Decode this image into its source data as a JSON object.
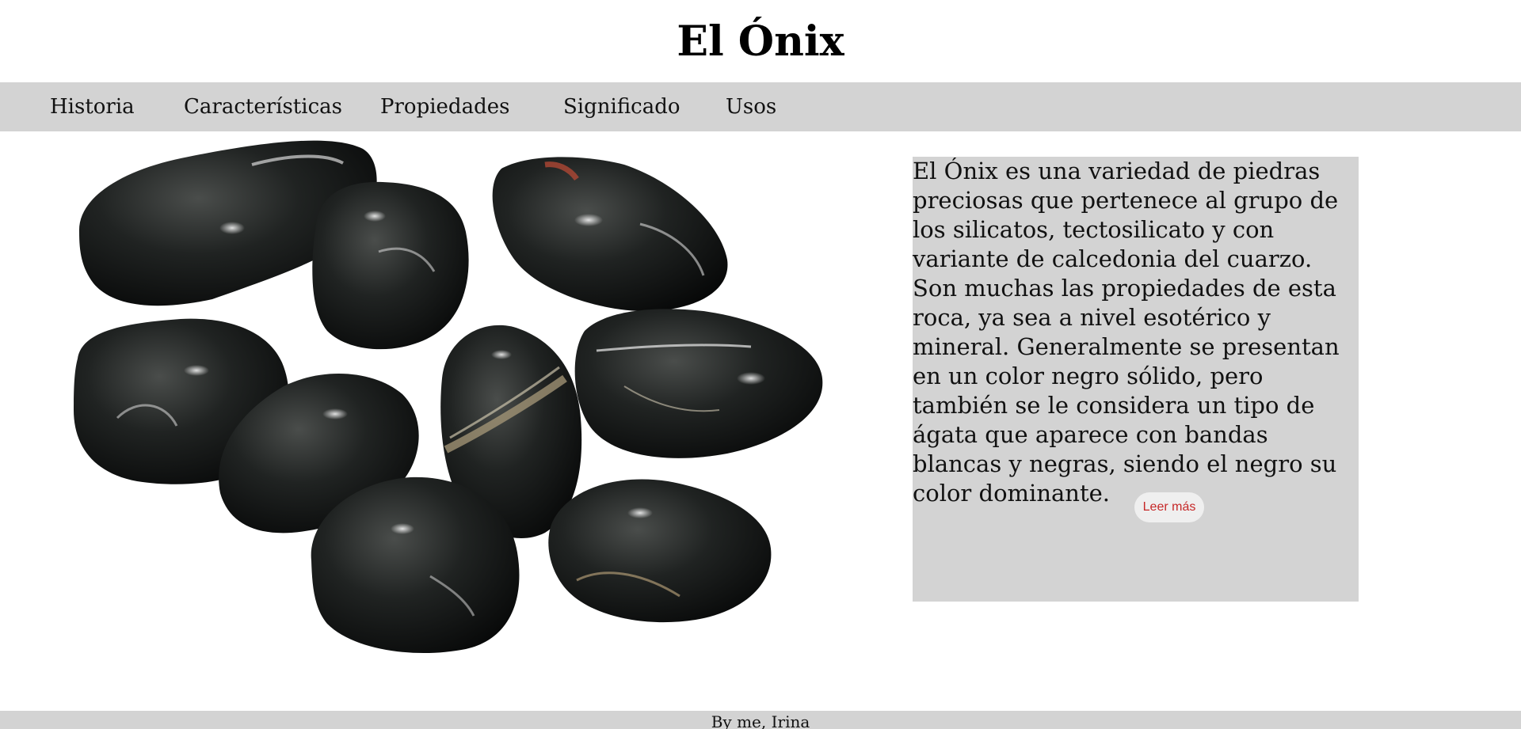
{
  "header": {
    "title": "El Ónix"
  },
  "nav": {
    "items": [
      {
        "label": "Historia"
      },
      {
        "label": "Características"
      },
      {
        "label": "Propiedades"
      },
      {
        "label": "Significado"
      },
      {
        "label": "Usos"
      }
    ]
  },
  "main": {
    "image_subject": "black onyx tumbled stones",
    "paragraphs": [
      "El Ónix es una variedad de piedras preciosas que pertenece al grupo de los silicatos, tectosilicato y con variante de calcedonia del cuarzo.",
      "Son muchas las propiedades de esta roca, ya sea a nivel esotérico y mineral. Generalmente se presentan en un color negro sólido, pero también se le considera un tipo de ágata que aparece con bandas blancas y negras, siendo el negro su color dominante."
    ],
    "read_more_label": "Leer más"
  },
  "footer": {
    "text": "By me, Irina"
  },
  "colors": {
    "nav_background": "#d3d3d3",
    "panel_background": "#d3d3d3",
    "button_background": "#efefef",
    "button_text": "#c62828",
    "page_background": "#ffffff"
  }
}
